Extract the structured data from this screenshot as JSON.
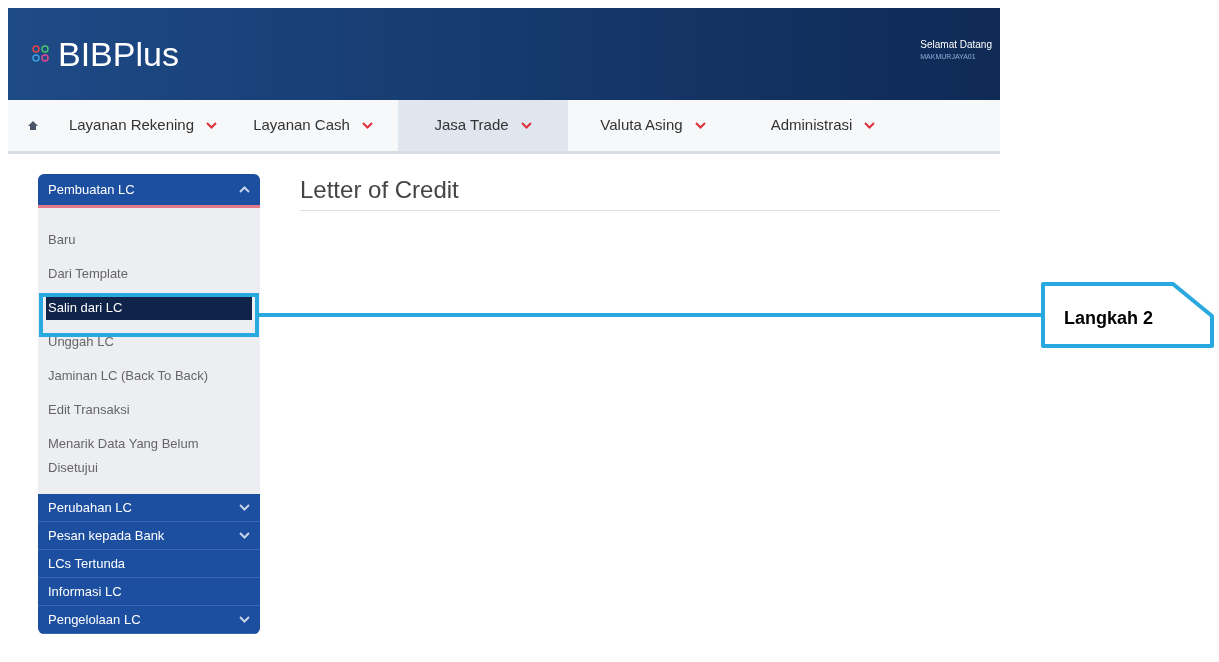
{
  "header": {
    "logo": "BIBPlus",
    "greeting": "Selamat Datang",
    "username": "MAKMURJAYA01"
  },
  "nav": [
    {
      "label": "Layanan Rekening",
      "selected": false
    },
    {
      "label": "Layanan Cash",
      "selected": false
    },
    {
      "label": "Jasa Trade",
      "selected": true
    },
    {
      "label": "Valuta Asing",
      "selected": false
    },
    {
      "label": "Administrasi",
      "selected": false
    }
  ],
  "sidebar": [
    {
      "label": "Pembuatan LC",
      "expanded": true,
      "has_children": true,
      "children": [
        {
          "label": "Baru",
          "selected": false
        },
        {
          "label": "Dari Template",
          "selected": false
        },
        {
          "label": "Salin dari LC",
          "selected": true
        },
        {
          "label": "Unggah LC",
          "selected": false
        },
        {
          "label": "Jaminan LC (Back To Back)",
          "selected": false
        },
        {
          "label": "Edit Transaksi",
          "selected": false
        },
        {
          "label": "Menarik Data Yang Belum Disetujui",
          "selected": false
        }
      ]
    },
    {
      "label": "Perubahan LC",
      "expanded": false,
      "has_children": true
    },
    {
      "label": "Pesan kepada Bank",
      "expanded": false,
      "has_children": true
    },
    {
      "label": "LCs Tertunda",
      "expanded": false,
      "has_children": false
    },
    {
      "label": "Informasi LC",
      "expanded": false,
      "has_children": false
    },
    {
      "label": "Pengelolaan LC",
      "expanded": false,
      "has_children": true
    }
  ],
  "page_title": "Letter of Credit",
  "annotation": {
    "label": "Langkah 2"
  }
}
